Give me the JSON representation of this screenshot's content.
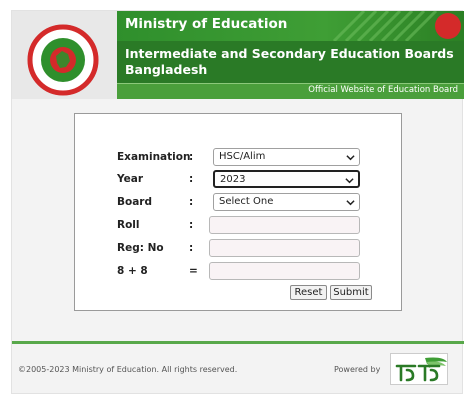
{
  "header": {
    "ministry": "Ministry of Education",
    "boards": "Intermediate and Secondary Education Boards Bangladesh",
    "official": "Official Website of Education Board"
  },
  "form": {
    "examination": {
      "label": "Examination",
      "colon": ":",
      "value": "HSC/Alim"
    },
    "year": {
      "label": "Year",
      "colon": ":",
      "value": "2023"
    },
    "board": {
      "label": "Board",
      "colon": ":",
      "value": "Select One"
    },
    "roll": {
      "label": "Roll",
      "colon": ":",
      "value": ""
    },
    "reg": {
      "label": "Reg: No",
      "colon": ":",
      "value": ""
    },
    "captcha": {
      "label": "8 + 8",
      "colon": "=",
      "value": ""
    },
    "reset_label": "Reset",
    "submit_label": "Submit"
  },
  "footer": {
    "copyright": "©2005-2023 Ministry of Education. All rights reserved.",
    "powered": "Powered by"
  },
  "colors": {
    "green": "#2f8f2c",
    "dark_green": "#2a7a26",
    "seal_red": "#d42a2a"
  },
  "icons": {
    "seal": "government-seal-icon",
    "chevron": "chevron-down-icon",
    "tech": "teletalk-logo-icon"
  }
}
